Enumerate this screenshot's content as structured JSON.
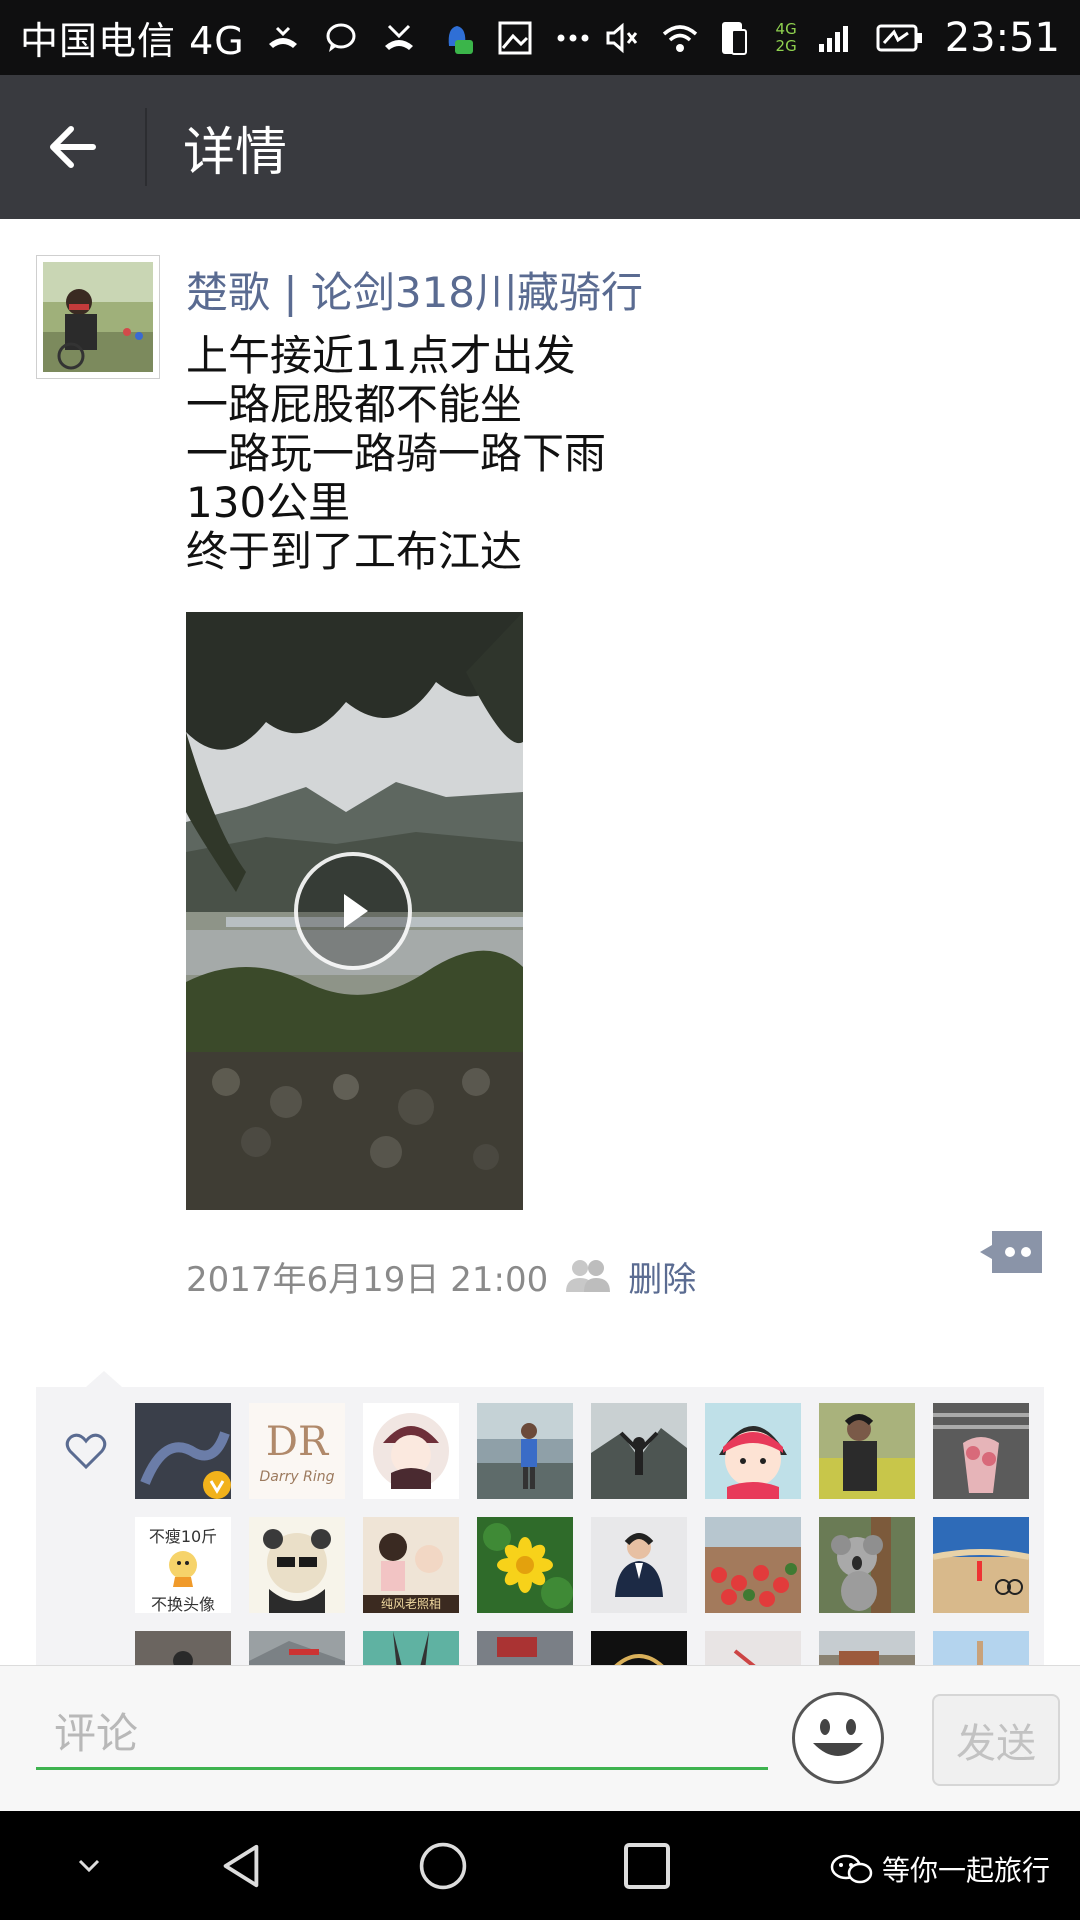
{
  "status_bar": {
    "carrier": "中国电信 4G",
    "network_label_top": "4G",
    "network_label_bottom": "2G",
    "time": "23:51"
  },
  "app_bar": {
    "title": "详情"
  },
  "post": {
    "username": "楚歌 | 论剑318川藏骑行",
    "text_lines": [
      "上午接近11点才出发",
      "一路屁股都不能坐",
      "一路玩一路骑一路下雨",
      "130公里",
      "终于到了工布江达"
    ],
    "timestamp": "2017年6月19日 21:00",
    "delete_label": "删除"
  },
  "likes": {
    "avatar_texts": {
      "darry_ring": "Darry Ring",
      "dr_logo": "DR",
      "no_loss": "不瘦10斤",
      "no_change": "不换头像",
      "studio": "纯风老照相"
    }
  },
  "comment_bar": {
    "placeholder": "评论",
    "send_label": "发送"
  },
  "nav_bar": {
    "watermark": "等你一起旅行"
  },
  "colors": {
    "status_bar_bg": "#0f0f10",
    "app_bar_bg": "#393a3f",
    "link_blue": "#5a6b91",
    "input_underline": "#3eb34f"
  }
}
